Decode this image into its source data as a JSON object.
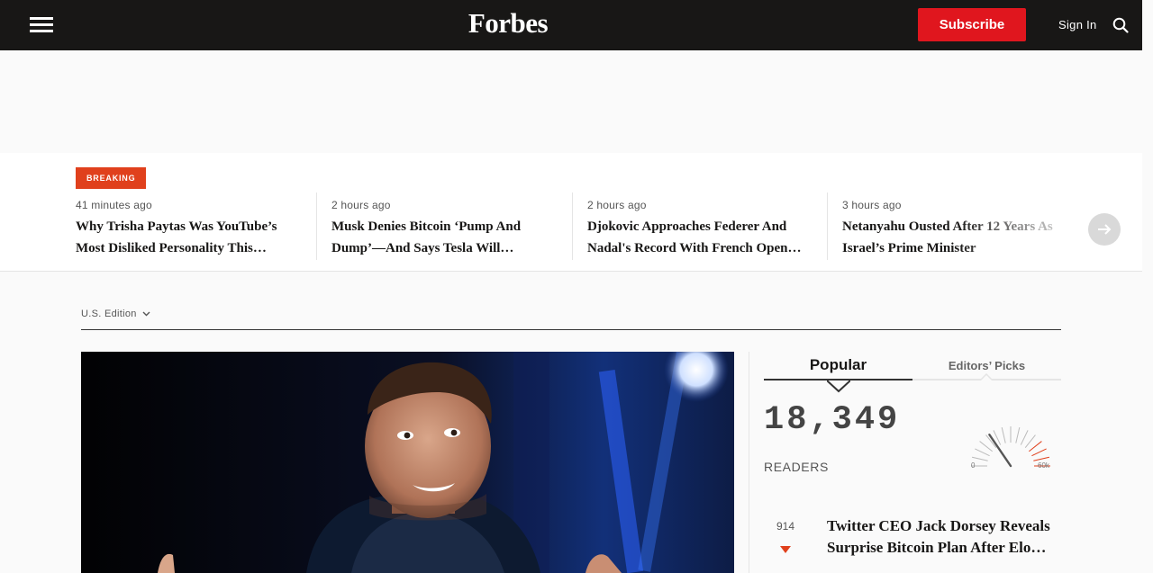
{
  "header": {
    "logo": "Forbes",
    "subscribe_label": "Subscribe",
    "signin_label": "Sign In",
    "bg_color": "#181716",
    "accent_color": "#e0161e"
  },
  "breaking": {
    "badge": "BREAKING",
    "stories": [
      {
        "time": "41 minutes ago",
        "headline": "Why Trisha Paytas Was YouTube’s Most Disliked Personality This…"
      },
      {
        "time": "2 hours ago",
        "headline": "Musk Denies Bitcoin ‘Pump And Dump’—And Says Tesla Will…"
      },
      {
        "time": "2 hours ago",
        "headline": "Djokovic Approaches Federer And Nadal's Record With French Open…"
      },
      {
        "time": "3 hours ago",
        "headline": "Netanyahu Ousted After 12 Years As Israel’s Prime Minister"
      }
    ]
  },
  "edition": {
    "label": "U.S. Edition"
  },
  "sidebar": {
    "tabs": {
      "popular": "Popular",
      "editors": "Editors’ Picks"
    },
    "readers": {
      "count": "18,349",
      "label": "READERS",
      "gauge_min": "0",
      "gauge_max": "60k",
      "gauge_level": 0.31
    },
    "popular_items": [
      {
        "rank": "914",
        "trend": "down",
        "headline": "Twitter CEO Jack Dorsey Reveals Surprise Bitcoin Plan After Elo…"
      }
    ]
  }
}
